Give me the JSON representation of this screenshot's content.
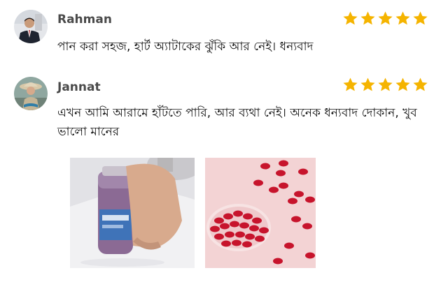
{
  "reviews": [
    {
      "name": "Rahman",
      "rating": 5,
      "text": "পান করা সহজ, হার্ট অ্যাটাকের ঝুঁকি আর নেই। ধন্যবাদ"
    },
    {
      "name": "Jannat",
      "rating": 5,
      "text": "এখন আমি আরামে হাঁটতে পারি, আর ব্যথা নেই। অনেক ধন্যবাদ দোকান, খুব ভালো মানের"
    }
  ],
  "icons": {
    "star": "star-icon"
  },
  "colors": {
    "star": "#f5b400",
    "name": "#4a4a4a",
    "pill": "#d8182e"
  }
}
